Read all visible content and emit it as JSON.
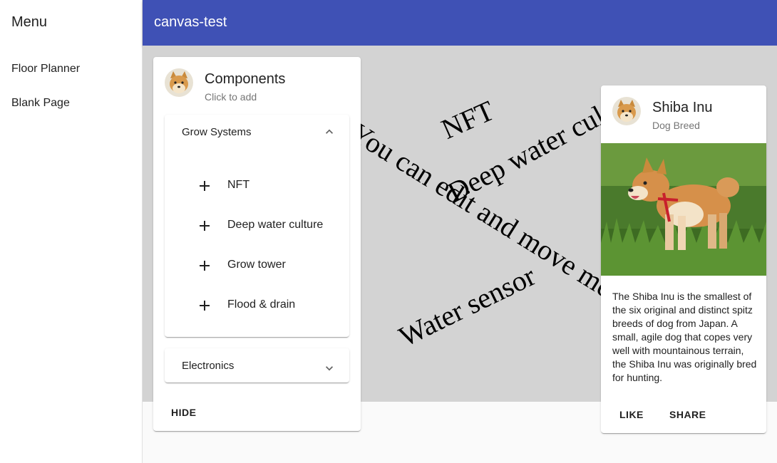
{
  "drawer": {
    "title": "Menu",
    "items": [
      {
        "label": "Floor Planner"
      },
      {
        "label": "Blank Page"
      }
    ]
  },
  "appbar": {
    "title": "canvas-test"
  },
  "canvas": {
    "texts": [
      {
        "text": "NFT",
        "angle": -24
      },
      {
        "text": "Deep water culture",
        "angle": -28
      },
      {
        "text": "You can edit and move me",
        "angle": 32
      },
      {
        "text": "Water sensor",
        "angle": -26
      }
    ]
  },
  "components": {
    "title": "Components",
    "subtitle": "Click to add",
    "panels": [
      {
        "label": "Grow Systems",
        "expanded": true,
        "items": [
          {
            "label": "NFT"
          },
          {
            "label": "Deep water culture"
          },
          {
            "label": "Grow tower"
          },
          {
            "label": "Flood & drain"
          }
        ]
      },
      {
        "label": "Electronics",
        "expanded": false
      }
    ],
    "hide_label": "HIDE"
  },
  "dog_card": {
    "title": "Shiba Inu",
    "subtitle": "Dog Breed",
    "description": "The Shiba Inu is the smallest of the six original and distinct spitz breeds of dog from Japan. A small, agile dog that copes very well with mountainous terrain, the Shiba Inu was originally bred for hunting.",
    "like_label": "LIKE",
    "share_label": "SHARE"
  },
  "colors": {
    "appbar": "#3f51b5",
    "canvas": "#d3d3d3"
  },
  "icons": [
    "shiba-avatar-icon",
    "chevron-up-icon",
    "chevron-down-icon",
    "plus-icon"
  ]
}
